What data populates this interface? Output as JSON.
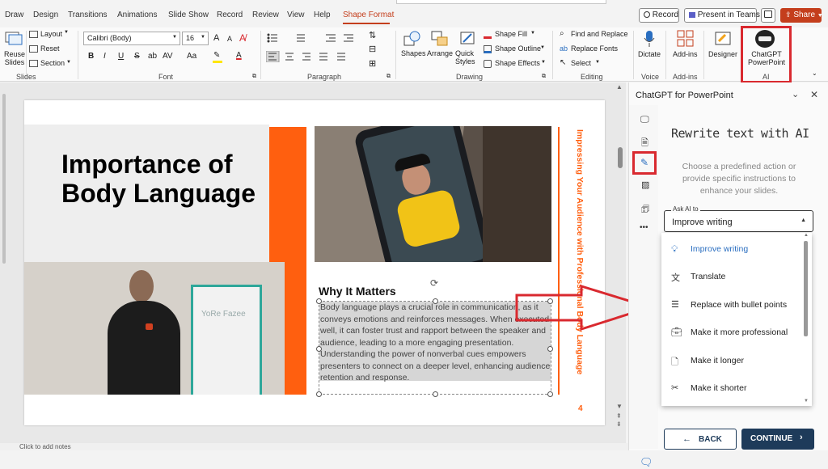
{
  "menu_tabs": [
    "Draw",
    "Design",
    "Transitions",
    "Animations",
    "Slide Show",
    "Record",
    "Review",
    "View",
    "Help",
    "Shape Format"
  ],
  "top_buttons": {
    "record": "Record",
    "present": "Present in Teams",
    "share": "Share"
  },
  "ribbon": {
    "slides": {
      "reuse": "Reuse Slides",
      "layout": "Layout",
      "reset": "Reset",
      "section": "Section",
      "group": "Slides"
    },
    "font": {
      "name": "Calibri (Body)",
      "size": "16",
      "group": "Font",
      "bold": "B",
      "italic": "I",
      "underline": "U",
      "strike": "S",
      "shadow": "ab",
      "spacing": "AV",
      "case": "Aa",
      "grow": "A",
      "shrink": "A"
    },
    "paragraph": {
      "group": "Paragraph"
    },
    "drawing": {
      "shapes": "Shapes",
      "arrange": "Arrange",
      "quick_styles": "Quick Styles",
      "fill": "Shape Fill",
      "outline": "Shape Outline",
      "effects": "Shape Effects",
      "group": "Drawing"
    },
    "editing": {
      "find": "Find and Replace",
      "replace_fonts": "Replace Fonts",
      "select": "Select",
      "group": "Editing"
    },
    "voice": {
      "dictate": "Dictate",
      "group": "Voice"
    },
    "addins": {
      "addins": "Add-ins",
      "group": "Add-ins"
    },
    "designer": {
      "label": "Designer"
    },
    "ai": {
      "label": "ChatGPT PowerPoint",
      "group": "AI"
    }
  },
  "slide": {
    "title": "Importance of Body Language",
    "side_text": "Impressing Your Audience with Professional Body Language",
    "heading": "Why It Matters",
    "body": "Body language plays a crucial role in communication, as it conveys emotions and reinforces messages. When executed well, it can foster trust and rapport between the speaker and audience, leading to a more engaging presentation. Understanding the power of nonverbal cues empowers presenters to connect on a deeper level, enhancing audience retention and response.",
    "page_number": "4",
    "flipchart_text": "YoRe Fazee"
  },
  "status_text": "Click to add notes",
  "pane": {
    "title": "ChatGPT for PowerPoint",
    "heading": "Rewrite text with AI",
    "description": "Choose a predefined action or provide specific instructions to enhance your slides.",
    "field_label": "Ask AI to",
    "field_value": "Improve writing",
    "options": [
      "Improve writing",
      "Translate",
      "Replace with bullet points",
      "Make it more professional",
      "Make it longer",
      "Make it shorter"
    ],
    "back": "BACK",
    "continue": "CONTINUE"
  },
  "colors": {
    "accent": "#c43e1c",
    "orange": "#ff5f0f",
    "highlight": "#d9292f",
    "blue": "#2a6ec0",
    "navy": "#1e3b5a"
  }
}
